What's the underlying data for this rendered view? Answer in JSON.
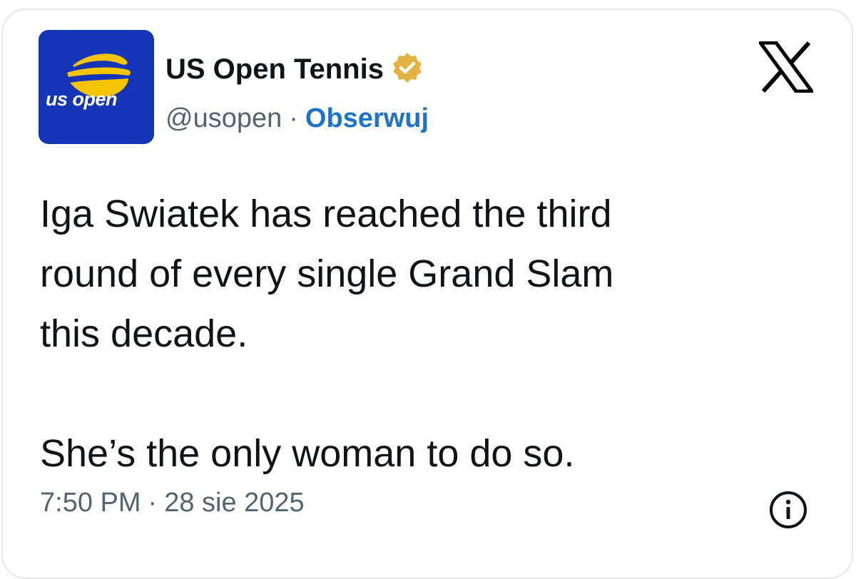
{
  "account": {
    "name": "US Open Tennis",
    "handle": "@usopen",
    "separator": "·",
    "follow_label": "Obserwuj",
    "avatar_logo_text": "us open",
    "avatar_color": "#1535b8",
    "avatar_ball_color": "#f5c400",
    "verified_badge_color": "#e3b341",
    "verified_icon": "verified-badge-icon"
  },
  "post": {
    "text_lines_1": "Iga Swiatek has reached the third",
    "text_lines_2": "round of every single Grand Slam",
    "text_lines_3": "this decade.",
    "text_lines_4": "She’s the only woman to do so."
  },
  "meta": {
    "time": "7:50 PM",
    "separator": "·",
    "date": "28 sie 2025"
  },
  "icons": {
    "brand": "x-logo-icon",
    "info": "info-icon"
  },
  "colors": {
    "text": "#0f1419",
    "secondary": "#536471",
    "link": "#1d72c9"
  }
}
